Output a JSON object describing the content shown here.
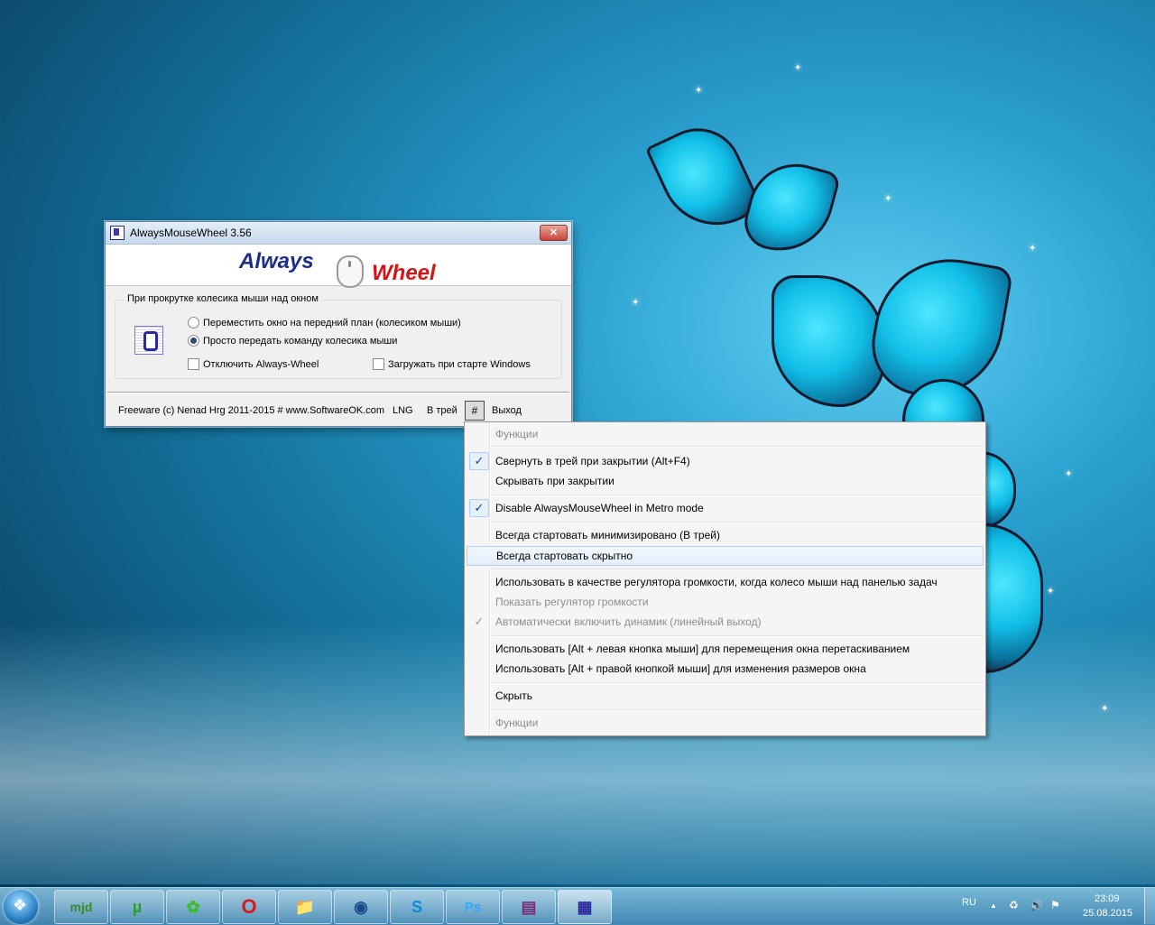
{
  "window": {
    "title": "AlwaysMouseWheel 3.56",
    "close_label": "✕",
    "logo_left": "Always",
    "logo_right": "Wheel",
    "group_title": "При прокрутке колесика мыши над окном",
    "radio_1": "Переместить окно на передний план (колесиком мыши)",
    "radio_2": "Просто передать команду колесика мыши",
    "check_disable": "Отключить Always-Wheel",
    "check_autostart": "Загружать при старте Windows",
    "footer_credit": "Freeware (c) Nenad Hrg 2011-2015 # www.SoftwareOK.com",
    "lng": "LNG",
    "to_tray": "В трей",
    "hash": "#",
    "exit": "Выход"
  },
  "menu": {
    "header": "Функции",
    "items": [
      "Свернуть в трей при закрытии (Alt+F4)",
      "Скрывать при закрытии",
      "Disable AlwaysMouseWheel in Metro mode",
      "Всегда стартовать минимизировано (В трей)",
      "Всегда стартовать скрытно",
      "Использовать в качестве регулятора громкости, когда колесо мыши над панелью задач",
      "Показать регулятор громкости",
      "Автоматически включить динамик (линейный выход)",
      "Использовать [Alt + левая кнопка мыши] для перемещения окна перетаскиванием",
      "Использовать [Alt + правой кнопкой мыши] для изменения размеров окна",
      "Скрыть"
    ],
    "footer": "Функции",
    "check_glyph": "✓"
  },
  "taskbar": {
    "apps": [
      "mjd",
      "µ",
      "✿",
      "O",
      "📁",
      "◉",
      "S",
      "Ps",
      "▤",
      "▦"
    ],
    "lang": "RU",
    "time": "23:09",
    "date": "25.08.2015",
    "tray_up": "▲",
    "tray_icons": [
      "♻",
      "🔊",
      "⚑"
    ]
  }
}
